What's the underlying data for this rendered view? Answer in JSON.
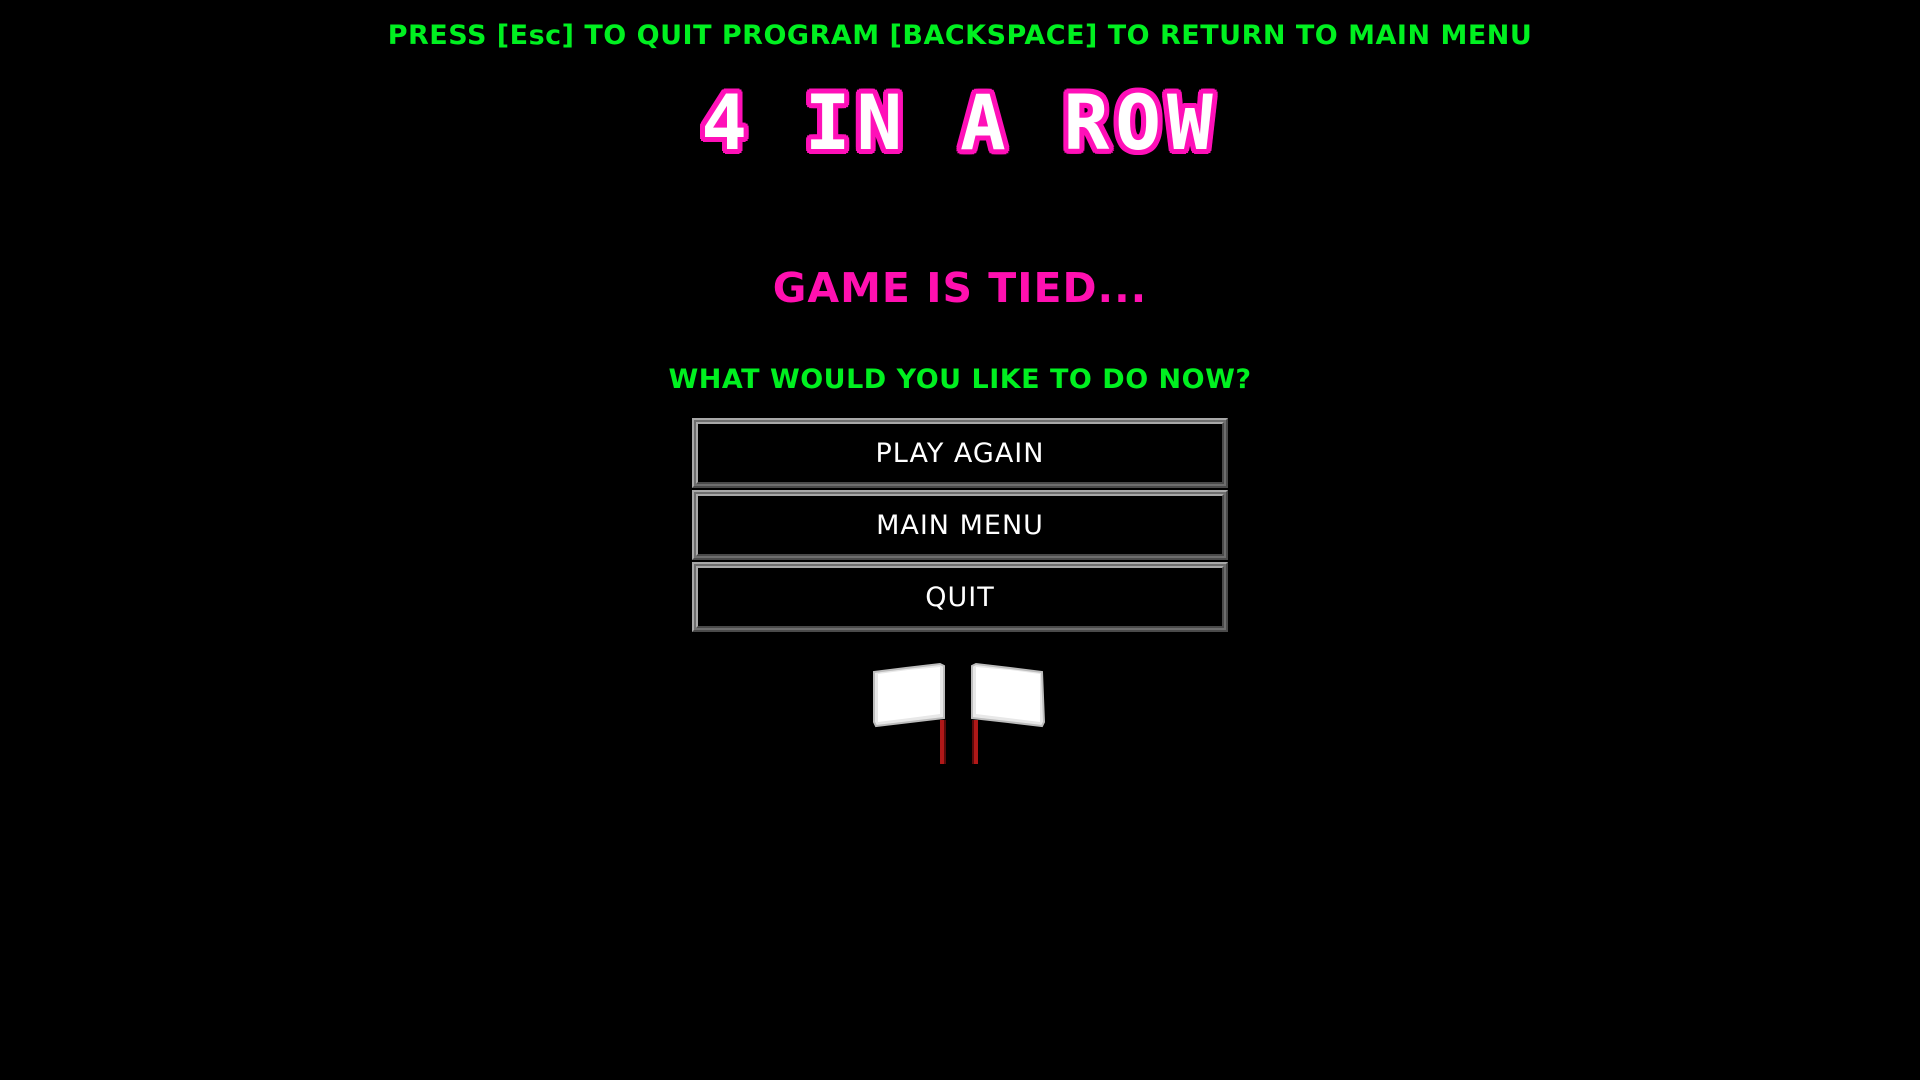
{
  "header": {
    "hint_text": "PRESS [Esc] TO QUIT PROGRAM [BACKSPACE] TO RETURN TO MAIN MENU",
    "title": "4 IN A ROW"
  },
  "result": {
    "status_text": "GAME IS TIED...",
    "prompt_text": "WHAT WOULD YOU LIKE TO DO NOW?"
  },
  "menu": {
    "play_again_label": "PLAY AGAIN",
    "main_menu_label": "MAIN MENU",
    "quit_label": "QUIT"
  },
  "graphic": {
    "icon": "white-flags-icon"
  },
  "colors": {
    "background": "#000000",
    "hint_green": "#00f020",
    "title_pink": "#ff10b8",
    "button_text": "#ffffff",
    "flag_pole": "#b01818"
  }
}
